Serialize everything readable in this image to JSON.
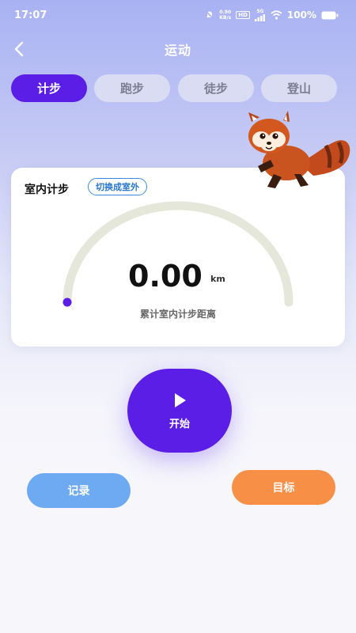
{
  "status_bar": {
    "time": "17:07",
    "net_speed_value": "0.90",
    "net_speed_unit": "KB/s",
    "hd_badge": "HD",
    "signal_label": "5G",
    "battery_text": "100%"
  },
  "header": {
    "title": "运动",
    "back_icon": "chevron-left-icon"
  },
  "tabs": [
    {
      "label": "计步",
      "active": true
    },
    {
      "label": "跑步",
      "active": false
    },
    {
      "label": "徒步",
      "active": false
    },
    {
      "label": "登山",
      "active": false
    }
  ],
  "card": {
    "title": "室内计步",
    "switch_label": "切换成室外",
    "distance_value": "0.00",
    "distance_unit": "km",
    "distance_label": "累计室内计步距离",
    "progress": 0
  },
  "actions": {
    "start_label": "开始",
    "start_icon": "play-icon",
    "record_label": "记录",
    "goal_label": "目标"
  },
  "colors": {
    "accent": "#5b1ee6",
    "record_button": "#6eaaf2",
    "goal_button": "#f78f46",
    "switch_border": "#3a8dde"
  }
}
